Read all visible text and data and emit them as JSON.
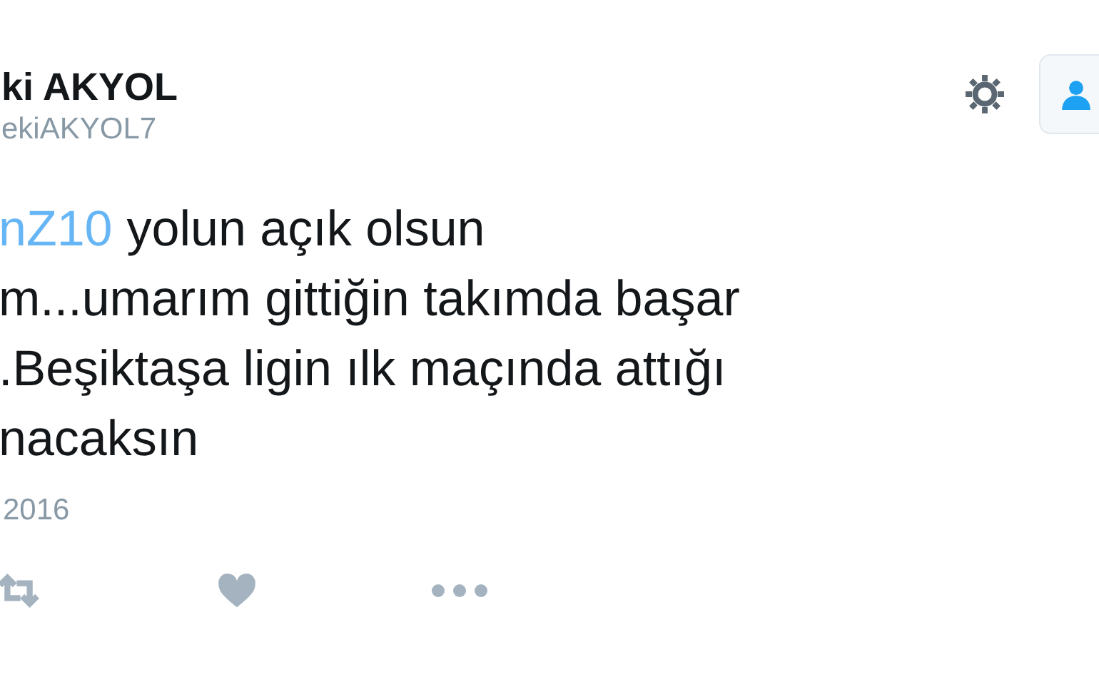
{
  "author": {
    "name": "ki AKYOL",
    "handle": "ekiAKYOL7"
  },
  "tweet_lines": [
    [
      {
        "kind": "mention",
        "text": "nZ10"
      },
      {
        "kind": "text",
        "text": "yolun açık olsun"
      }
    ],
    [
      {
        "kind": "text",
        "text": "m...umarım gittiğin takımda başar"
      }
    ],
    [
      {
        "kind": "text",
        "text": ".Beşiktaşa ligin ılk maçında attığı"
      }
    ],
    [
      {
        "kind": "text",
        "text": "nacaksın"
      }
    ]
  ],
  "date": "2016"
}
